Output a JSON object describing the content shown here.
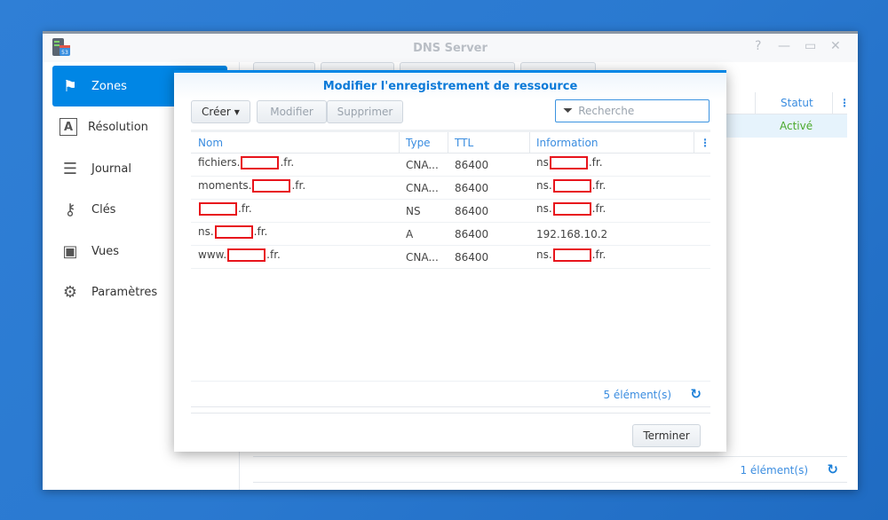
{
  "window": {
    "title": "DNS Server",
    "controls": {
      "help": "?",
      "minimize": "—",
      "maximize": "▭",
      "close": "✕"
    }
  },
  "sidebar": {
    "items": [
      {
        "label": "Zones",
        "icon": "flag-icon",
        "active": true
      },
      {
        "label": "Résolution",
        "icon": "resolution-icon"
      },
      {
        "label": "Journal",
        "icon": "log-icon"
      },
      {
        "label": "Clés",
        "icon": "key-icon"
      },
      {
        "label": "Vues",
        "icon": "views-icon"
      },
      {
        "label": "Paramètres",
        "icon": "gear-icon"
      }
    ]
  },
  "background": {
    "status_header": "Statut",
    "status_value": "Activé",
    "count": "1 élément(s)"
  },
  "dialog": {
    "title": "Modifier l'enregistrement de ressource",
    "create": "Créer",
    "modify": "Modifier",
    "delete": "Supprimer",
    "search_placeholder": "Recherche",
    "columns": [
      "Nom",
      "Type",
      "TTL",
      "Information"
    ],
    "rows": [
      {
        "name_prefix": "fichiers.",
        "name_suffix": ".fr.",
        "type": "CNA...",
        "ttl": "86400",
        "info_prefix": "ns",
        "info_suffix": ".fr."
      },
      {
        "name_prefix": "moments.",
        "name_suffix": ".fr.",
        "type": "CNA...",
        "ttl": "86400",
        "info_prefix": "ns.",
        "info_suffix": ".fr."
      },
      {
        "name_prefix": "",
        "name_suffix": ".fr.",
        "type": "NS",
        "ttl": "86400",
        "info_prefix": "ns.",
        "info_suffix": ".fr."
      },
      {
        "name_prefix": "ns.",
        "name_suffix": ".fr.",
        "type": "A",
        "ttl": "86400",
        "info_prefix": "192.168.10.2",
        "info_suffix": ""
      },
      {
        "name_prefix": "www.",
        "name_suffix": ".fr.",
        "type": "CNA...",
        "ttl": "86400",
        "info_prefix": "ns.",
        "info_suffix": ".fr."
      }
    ],
    "count": "5 élément(s)",
    "finish": "Terminer"
  },
  "colors": {
    "accent": "#0086e5",
    "active_status": "#4aa92b",
    "redaction": "#e8141c"
  }
}
